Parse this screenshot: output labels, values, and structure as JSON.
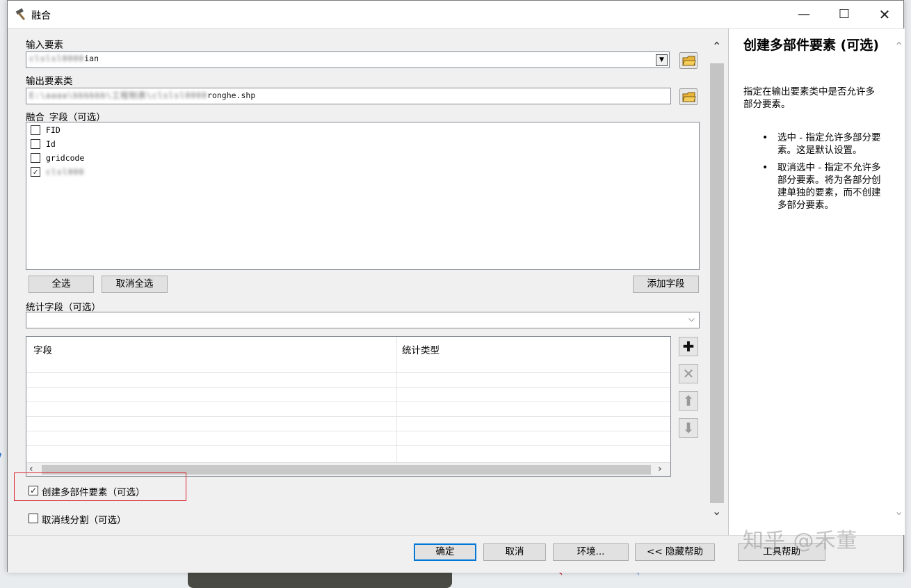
{
  "window": {
    "title": "融合",
    "min_glyph": "—",
    "max_glyph": "☐",
    "close_glyph": "✕"
  },
  "input_features": {
    "label": "输入要素",
    "value_blurred": "clslsl0000",
    "value_suffix": "ian"
  },
  "output_feature_class": {
    "label": "输出要素类",
    "value_blurred": "E:\\aaaa\\bbbbbb\\工程制表\\clslsl0000",
    "value_suffix": "ronghe.shp"
  },
  "dissolve_fields": {
    "label": "融合_字段（可选）",
    "items": [
      {
        "name": "FID",
        "checked": false
      },
      {
        "name": "Id",
        "checked": false
      },
      {
        "name": "gridcode",
        "checked": false
      },
      {
        "name": "clsl000",
        "checked": true,
        "blurred": true
      }
    ],
    "select_all": "全选",
    "clear_all": "取消全选",
    "add_field": "添加字段"
  },
  "statistics_fields": {
    "label": "统计字段（可选）",
    "columns": [
      "字段",
      "统计类型"
    ],
    "add_glyph": "✚",
    "remove_glyph": "✕",
    "up_glyph": "⬆",
    "down_glyph": "⬇"
  },
  "multipart": {
    "label": "创建多部件要素（可选）",
    "checked": true
  },
  "unsplit": {
    "label": "取消线分割（可选）",
    "checked": false
  },
  "footer": {
    "ok": "确定",
    "cancel": "取消",
    "env": "环境...",
    "hide_help": "<< 隐藏帮助",
    "tool_help": "工具帮助"
  },
  "help": {
    "title": "创建多部件要素 (可选)",
    "description": "指定在输出要素类中是否允许多部分要素。",
    "bullets": [
      "选中 - 指定允许多部分要素。这是默认设置。",
      "取消选中 - 指定不允许多部分要素。将为各部分创建单独的要素，而不创建多部分要素。"
    ]
  },
  "watermark": "知乎 @禾董",
  "colors": {
    "accent": "#0078d7",
    "highlight": "#d9232d",
    "folder": "#e8b43a"
  }
}
